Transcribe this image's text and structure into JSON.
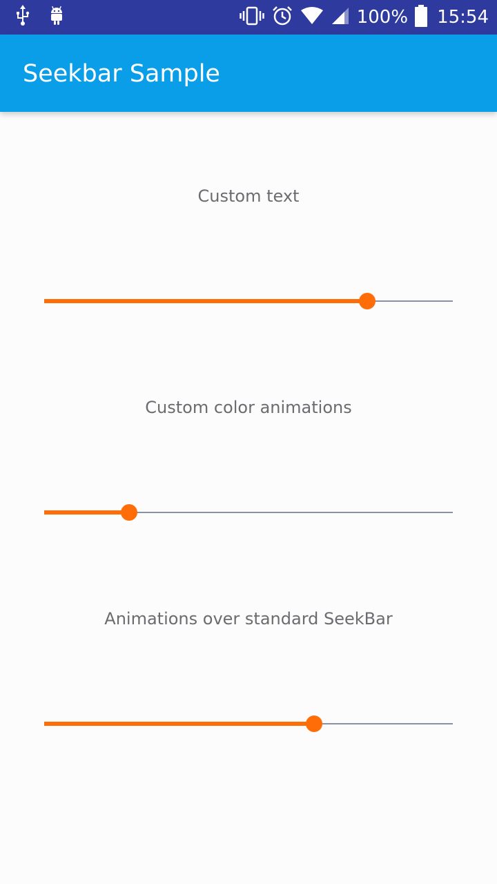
{
  "status_bar": {
    "left_icons": [
      "usb-icon",
      "android-debug-icon"
    ],
    "right_icons": [
      "vibrate-icon",
      "alarm-icon",
      "wifi-icon",
      "cellular-signal-icon"
    ],
    "battery_percent": "100%",
    "time": "15:54",
    "background_color": "#2f3a9e"
  },
  "app_bar": {
    "title": "Seekbar Sample",
    "background_color": "#0a9ee8"
  },
  "seekbars": [
    {
      "label": "Custom text",
      "progress": 0.79
    },
    {
      "label": "Custom color animations",
      "progress": 0.207
    },
    {
      "label": "Animations over standard SeekBar",
      "progress": 0.66
    }
  ],
  "colors": {
    "accent": "#ff6d08",
    "track": "#8a8fa8",
    "label_text": "#6b6b70"
  }
}
